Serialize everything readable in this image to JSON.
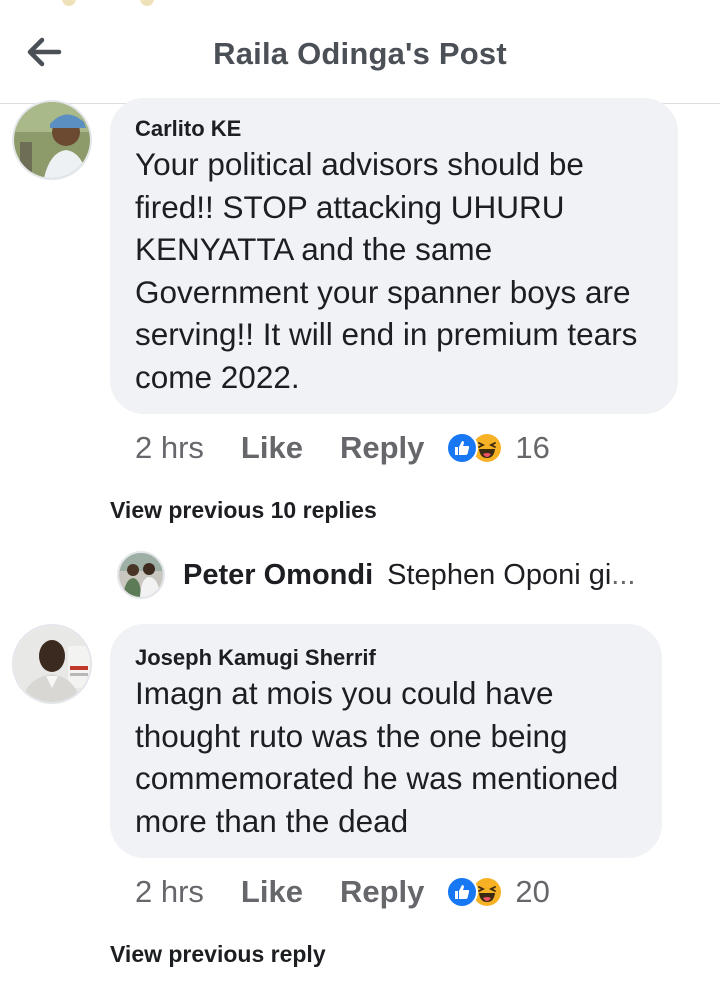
{
  "header": {
    "title": "Raila Odinga's Post",
    "back_icon": "arrow-left-icon"
  },
  "comments": [
    {
      "author": "Carlito KE",
      "text_lines": [
        "Your political advisors should be",
        "fired!! STOP attacking UHURU",
        "KENYATTA and the same",
        "Government your spanner boys are",
        "serving!! It will end in premium tears",
        "come 2022."
      ],
      "time": "2 hrs",
      "like_label": "Like",
      "reply_label": "Reply",
      "reaction_count": "16",
      "reactions": [
        "like-reaction-icon",
        "haha-reaction-icon"
      ],
      "view_replies_label": "View previous 10 replies"
    },
    {
      "author": "Joseph Kamugi Sherrif",
      "text_lines": [
        "Imagn at mois you could have",
        "thought ruto was the one being",
        "commemorated he was mentioned",
        "more than the dead"
      ],
      "time": "2 hrs",
      "like_label": "Like",
      "reply_label": "Reply",
      "reaction_count": "20",
      "reactions": [
        "like-reaction-icon",
        "haha-reaction-icon"
      ],
      "view_replies_label": "View previous reply"
    }
  ],
  "reply_preview": {
    "author": "Peter Omondi",
    "snippet": "Stephen Oponi gi",
    "ellipsis": "..."
  },
  "colors": {
    "accent": "#1877f2",
    "bubble": "#f0f2f5",
    "secondary_text": "#65676b",
    "primary_text": "#1c1e21"
  }
}
